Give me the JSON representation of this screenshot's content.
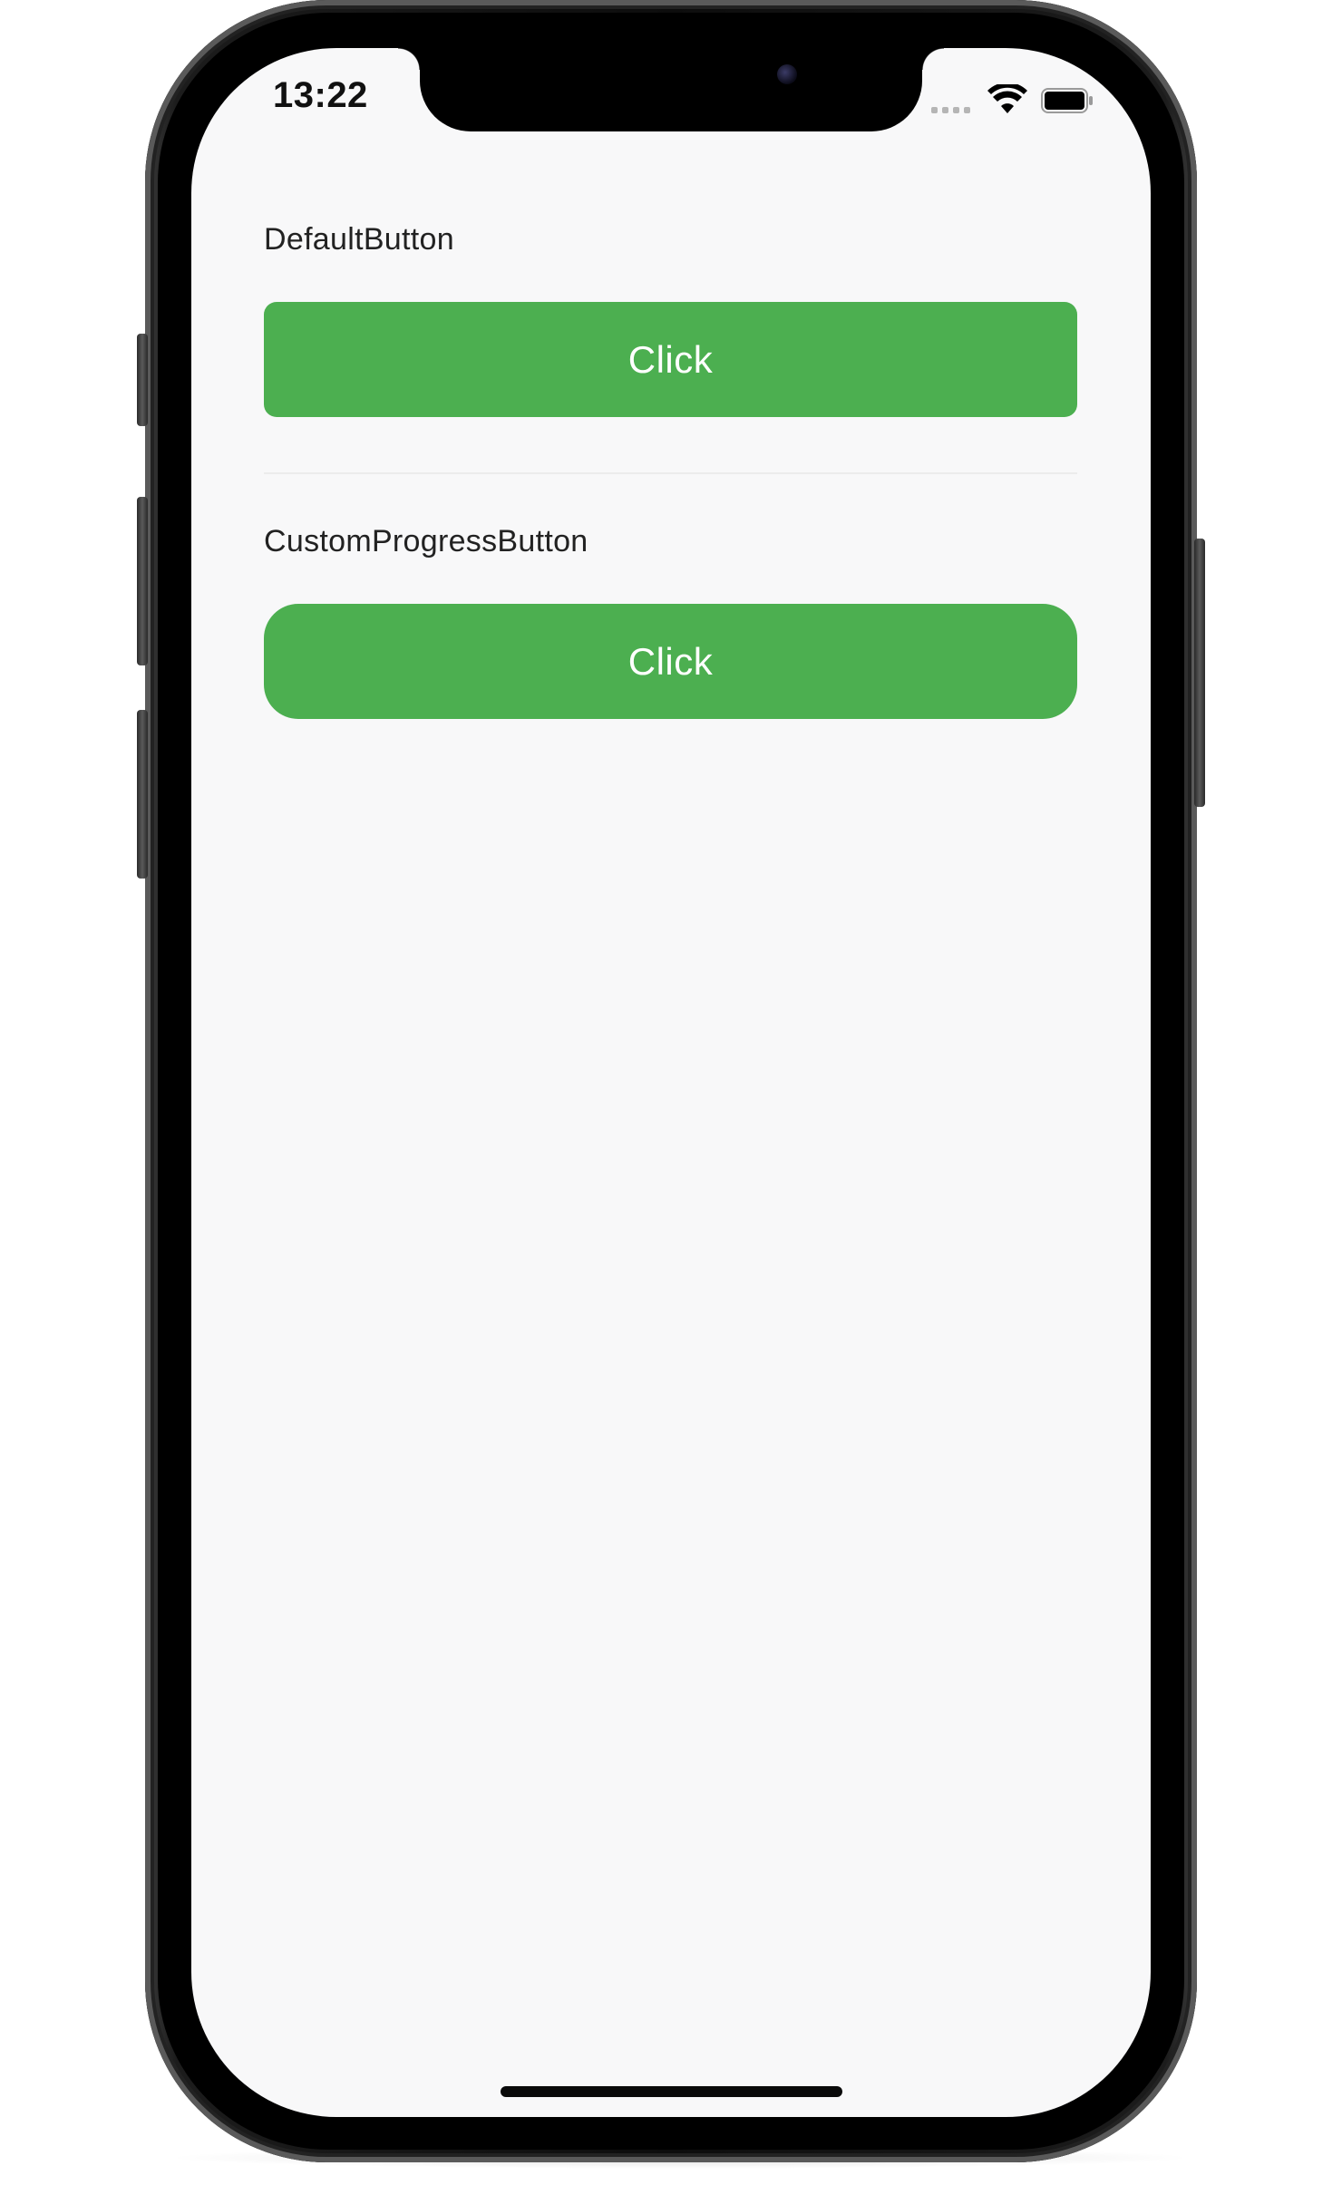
{
  "status_bar": {
    "time": "13:22",
    "wifi_icon": "wifi-icon",
    "battery_icon": "battery-icon",
    "signal_icon": "cellular-signal-icon"
  },
  "sections": [
    {
      "label": "DefaultButton",
      "button_label": "Click"
    },
    {
      "label": "CustomProgressButton",
      "button_label": "Click"
    }
  ],
  "colors": {
    "button_background": "#4caf50",
    "button_text": "#ffffff",
    "screen_background": "#f8f8f9",
    "label_text": "#222222"
  }
}
